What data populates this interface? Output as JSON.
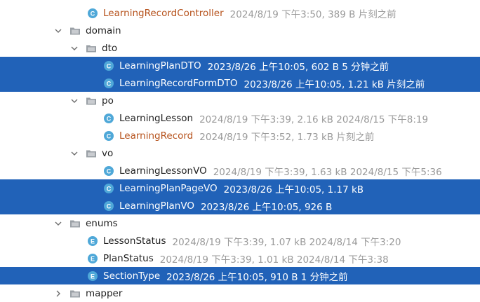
{
  "rows": [
    {
      "name": "LearningRecordController",
      "meta": "2024/8/19 下午3:50, 389 B 片刻之前",
      "icon": "class-icon"
    },
    {
      "name": "domain",
      "icon": "folder-icon"
    },
    {
      "name": "dto",
      "icon": "folder-icon"
    },
    {
      "name": "LearningPlanDTO",
      "meta": "2023/8/26 上午10:05, 602 B 5 分钟之前",
      "icon": "class-icon"
    },
    {
      "name": "LearningRecordFormDTO",
      "meta": "2023/8/26 上午10:05, 1.21 kB 片刻之前",
      "icon": "class-icon"
    },
    {
      "name": "po",
      "icon": "folder-icon"
    },
    {
      "name": "LearningLesson",
      "meta": "2024/8/19 下午3:39, 2.16 kB 2024/8/15 下午8:19",
      "icon": "class-icon"
    },
    {
      "name": "LearningRecord",
      "meta": "2024/8/19 下午3:52, 1.73 kB 片刻之前",
      "icon": "class-icon"
    },
    {
      "name": "vo",
      "icon": "folder-icon"
    },
    {
      "name": "LearningLessonVO",
      "meta": "2024/8/19 下午3:39, 1.63 kB 2024/8/15 下午5:36",
      "icon": "class-icon"
    },
    {
      "name": "LearningPlanPageVO",
      "meta": "2023/8/26 上午10:05, 1.17 kB",
      "icon": "class-icon"
    },
    {
      "name": "LearningPlanVO",
      "meta": "2023/8/26 上午10:05, 926 B",
      "icon": "class-icon"
    },
    {
      "name": "enums",
      "icon": "folder-icon"
    },
    {
      "name": "LessonStatus",
      "meta": "2024/8/19 下午3:39, 1.07 kB 2024/8/14 下午3:20",
      "icon": "enum-icon"
    },
    {
      "name": "PlanStatus",
      "meta": "2024/8/19 下午3:39, 1.01 kB 2024/8/14 下午3:38",
      "icon": "enum-icon"
    },
    {
      "name": "SectionType",
      "meta": "2023/8/26 上午10:05, 910 B 1 分钟之前",
      "icon": "enum-icon"
    },
    {
      "name": "mapper",
      "icon": "folder-icon"
    }
  ],
  "colors": {
    "selection": "#2162b8",
    "modified_text": "#b6521c",
    "meta_text": "#9a9a9a",
    "class_icon": "#4fa8d8",
    "enum_icon": "#4fa8d8",
    "folder_icon": "#9aa0a6"
  }
}
